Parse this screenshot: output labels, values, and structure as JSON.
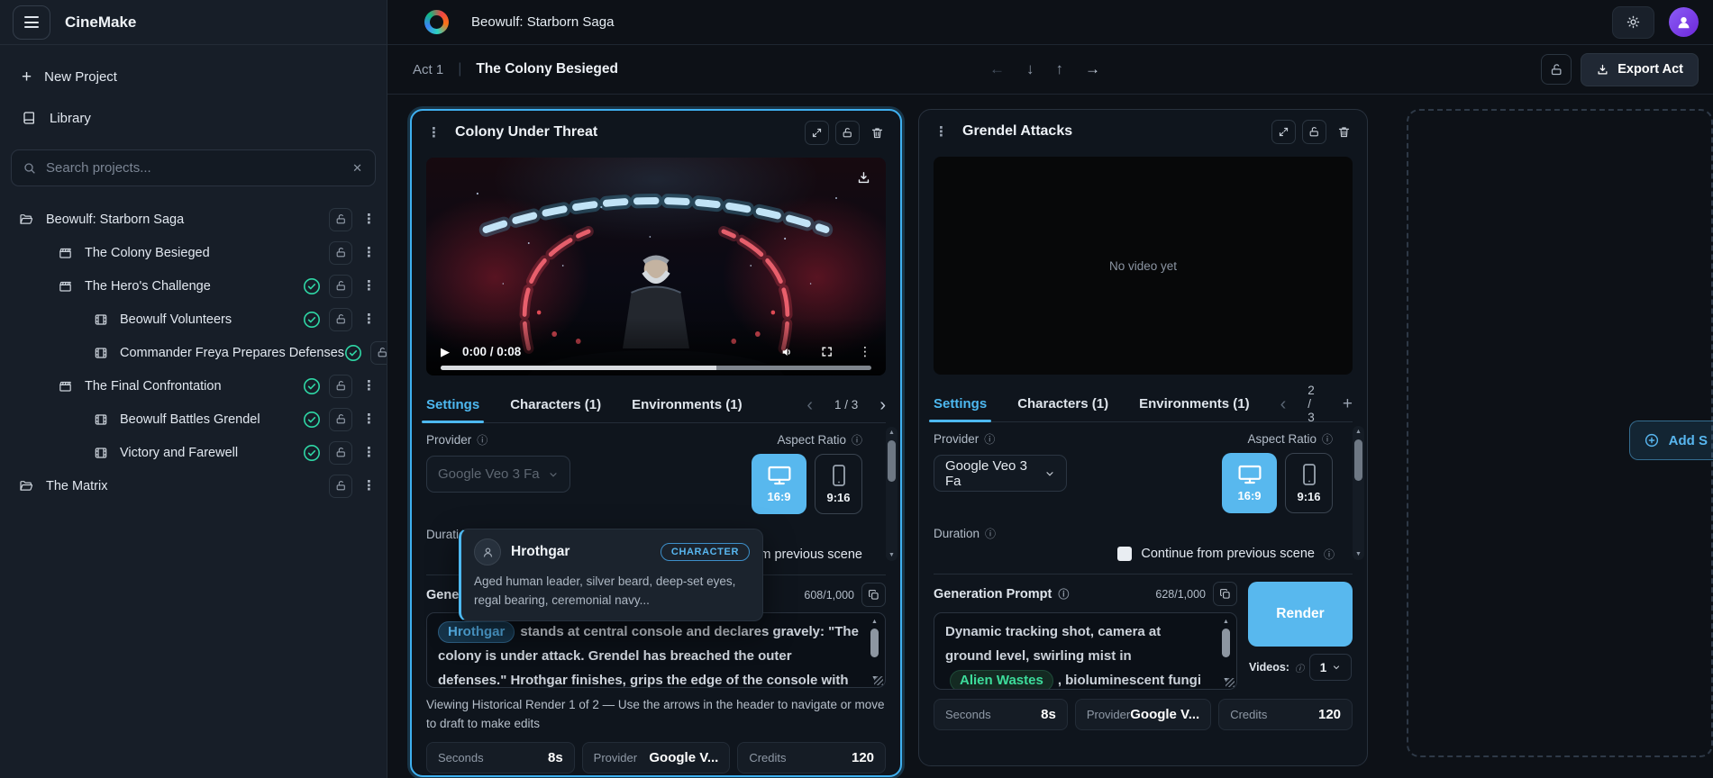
{
  "colors": {
    "accent": "#4DB8F0",
    "accent_fill": "#58B8EE",
    "success": "#2FD6A5",
    "chip_green": "#3DDC9B",
    "avatar_purple": "#8B5CF6"
  },
  "icons": {
    "info": "ⓘ",
    "kebab": "⋮",
    "play": "▶",
    "arrow_up": "▲",
    "arrow_down": "▼",
    "chevron_left": "‹",
    "chevron_right": "›",
    "plus": "+",
    "clear": "✕",
    "nav_left": "←",
    "nav_down": "↓",
    "nav_up": "↑",
    "nav_right": "→"
  },
  "app": {
    "name": "CineMake"
  },
  "sidebar": {
    "new_project": "New Project",
    "library": "Library",
    "search_placeholder": "Search projects...",
    "tree": [
      {
        "label": "Beowulf: Starborn Saga"
      },
      {
        "label": "The Colony Besieged"
      },
      {
        "label": "The Hero's Challenge"
      },
      {
        "label": "Beowulf Volunteers"
      },
      {
        "label": "Commander Freya Prepares Defenses"
      },
      {
        "label": "The Final Confrontation"
      },
      {
        "label": "Beowulf Battles Grendel"
      },
      {
        "label": "Victory and Farewell"
      },
      {
        "label": "The Matrix"
      }
    ]
  },
  "topbar": {
    "project_title": "Beowulf: Starborn Saga"
  },
  "act_header": {
    "act": "Act 1",
    "separator": "|",
    "title": "The Colony Besieged",
    "export_label": "Export Act"
  },
  "scene1": {
    "title": "Colony Under Threat",
    "video_time": "0:00 / 0:08",
    "tabs": {
      "settings": "Settings",
      "characters": "Characters (1)",
      "environments": "Environments (1)"
    },
    "pagination": "1 / 3",
    "provider_label": "Provider",
    "provider_value": "Google Veo 3 Fa",
    "aspect_label": "Aspect Ratio",
    "aspect_wide": "16:9",
    "aspect_tall": "9:16",
    "duration_label": "Duration",
    "continue_label": "Continue from previous scene",
    "prompt_label": "Generation Prompt",
    "char_count": "608/1,000",
    "prompt_chip": "Hrothgar",
    "prompt_text": "stands at central console and declares gravely: \"The colony is under attack. Grendel has breached the outer defenses.\" Hrothgar finishes, grips the edge of the console with solemn",
    "helper_text": "Viewing Historical Render 1 of 2 — Use the arrows in the header to navigate or move to draft to make edits",
    "stats": {
      "seconds_label": "Seconds",
      "seconds_value": "8s",
      "provider_label": "Provider",
      "provider_value": "Google V...",
      "credits_label": "Credits",
      "credits_value": "120"
    }
  },
  "tooltip": {
    "name": "Hrothgar",
    "badge": "CHARACTER",
    "description": "Aged human leader, silver beard, deep-set eyes, regal bearing, ceremonial navy..."
  },
  "scene2": {
    "title": "Grendel Attacks",
    "empty_video": "No video yet",
    "tabs": {
      "settings": "Settings",
      "characters": "Characters (1)",
      "environments": "Environments (1)"
    },
    "pagination": "2 / 3",
    "provider_label": "Provider",
    "provider_value": "Google Veo 3 Fa",
    "aspect_label": "Aspect Ratio",
    "aspect_wide": "16:9",
    "aspect_tall": "9:16",
    "duration_label": "Duration",
    "continue_label": "Continue from previous scene",
    "prompt_label": "Generation Prompt",
    "char_count": "628/1,000",
    "prompt_pre": "Dynamic tracking shot, camera at ground level, swirling mist in",
    "prompt_chip": "Alien Wastes",
    "prompt_post": ", bioluminescent fungi casting eerie light. Intense scary sci-fi",
    "render_label": "Render",
    "videos_label": "Videos:",
    "videos_value": "1",
    "stats": {
      "seconds_label": "Seconds",
      "seconds_value": "8s",
      "provider_label": "Provider",
      "provider_value": "Google V...",
      "credits_label": "Credits",
      "credits_value": "120"
    }
  },
  "add_scene_label": "Add S"
}
